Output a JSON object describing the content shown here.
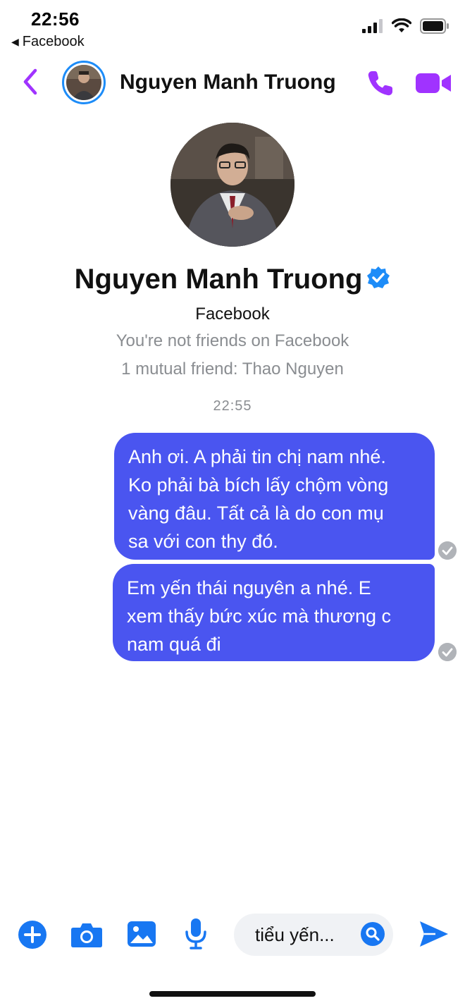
{
  "status_bar": {
    "time": "22:56",
    "back_app": "Facebook",
    "icons": [
      "signal-icon",
      "wifi-icon",
      "battery-icon"
    ]
  },
  "header": {
    "contact_name": "Nguyen Manh Truong",
    "icons": [
      "back-chevron-icon",
      "phone-icon",
      "video-camera-icon"
    ],
    "accent_color": "#a033ff"
  },
  "profile": {
    "name": "Nguyen Manh Truong",
    "verified": true,
    "source": "Facebook",
    "friendship_status": "You're not friends on Facebook",
    "mutual_friends": "1 mutual friend: Thao Nguyen"
  },
  "conversation": {
    "timestamp": "22:55",
    "messages": [
      {
        "lines": [
          "Anh ơi. A phải tin chị nam nhé.",
          "Ko phải bà bích lấy chộm vòng",
          "vàng đâu. Tất cả là do con mụ",
          "sa với con thy đó."
        ],
        "status": "seen"
      },
      {
        "lines": [
          "Em yến thái nguyên a nhé. E",
          "xem thấy bức xúc mà thương c",
          "nam quá đi"
        ],
        "status": "seen"
      }
    ],
    "bubble_color": "#4a55f0"
  },
  "composer": {
    "input_text": "tiểu yến...",
    "icons": [
      "plus-icon",
      "camera-icon",
      "gallery-icon",
      "microphone-icon",
      "search-icon",
      "send-icon"
    ],
    "icon_color": "#1877f2"
  }
}
